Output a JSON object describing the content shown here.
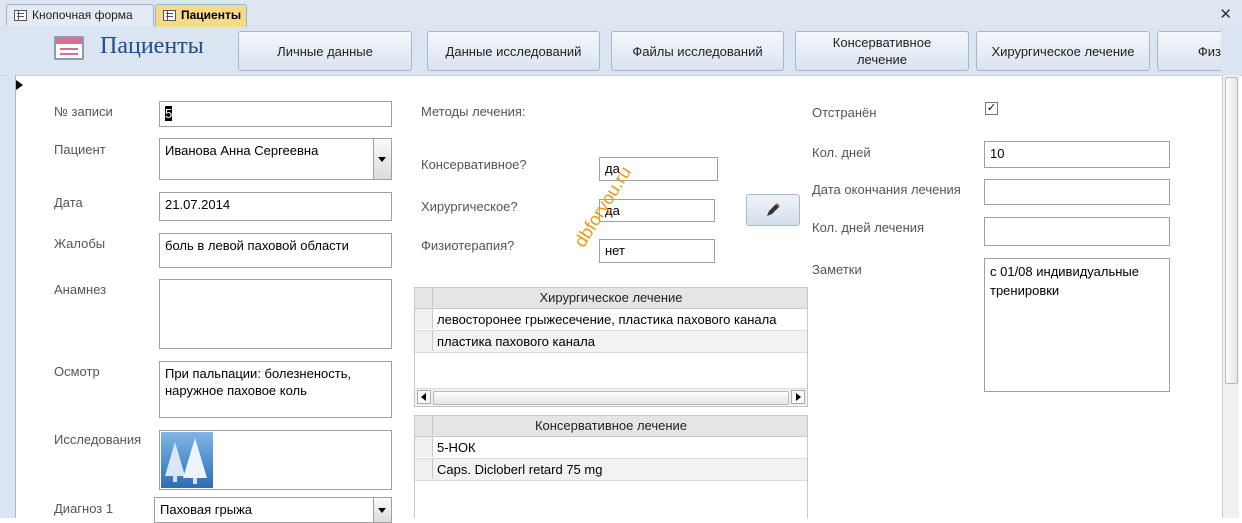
{
  "tabs": [
    {
      "label": "Кнопочная форма",
      "active": false
    },
    {
      "label": "Пациенты",
      "active": true
    }
  ],
  "header": {
    "title": "Пациенты",
    "buttons": [
      "Личные данные",
      "Данные исследований",
      "Файлы исследований",
      "Консервативное лечение",
      "Хирургическое лечение",
      "Физ"
    ]
  },
  "fields": {
    "record_no": {
      "label": "№ записи",
      "value": "5"
    },
    "patient": {
      "label": "Пациент",
      "value": "Иванова Анна Сергеевна"
    },
    "date": {
      "label": "Дата",
      "value": "21.07.2014"
    },
    "complaints": {
      "label": "Жалобы",
      "value": "боль в левой паховой области"
    },
    "anamnesis": {
      "label": "Анамнез",
      "value": ""
    },
    "exam": {
      "label": "Осмотр",
      "value": "При пальпации: болезненость, наружное паховое коль"
    },
    "research": {
      "label": "Исследования"
    },
    "diagnosis1": {
      "label": "Диагноз 1",
      "value": "Паховая грыжа"
    }
  },
  "treatment": {
    "heading": "Методы лечения:",
    "conservative": {
      "label": "Консервативное?",
      "value": "да"
    },
    "surgical": {
      "label": "Хирургическое?",
      "value": "да"
    },
    "physio": {
      "label": "Физиотерапия?",
      "value": "нет"
    }
  },
  "surgical_table": {
    "header": "Хирургическое лечение",
    "rows": [
      "левосторонее грыжесечение, пластика пахового канала",
      "пластика пахового канала"
    ]
  },
  "conservative_table": {
    "header": "Консервативное лечение",
    "rows": [
      "5-НОК",
      "Caps. Dicloberl retard 75 mg"
    ]
  },
  "right": {
    "suspended": {
      "label": "Отстранён",
      "checked": true
    },
    "days": {
      "label": "Кол. дней",
      "value": "10"
    },
    "end_date": {
      "label": "Дата окончания лечения",
      "value": ""
    },
    "treatment_days": {
      "label": "Кол. дней лечения",
      "value": ""
    },
    "notes": {
      "label": "Заметки",
      "value": "с 01/08 индивидуальные тренировки"
    }
  },
  "watermark": "dbforyou.ru",
  "icons": {
    "tab": "form-icon",
    "close": "close-icon",
    "edit": "pencil-icon",
    "record": "record-selector-icon"
  }
}
